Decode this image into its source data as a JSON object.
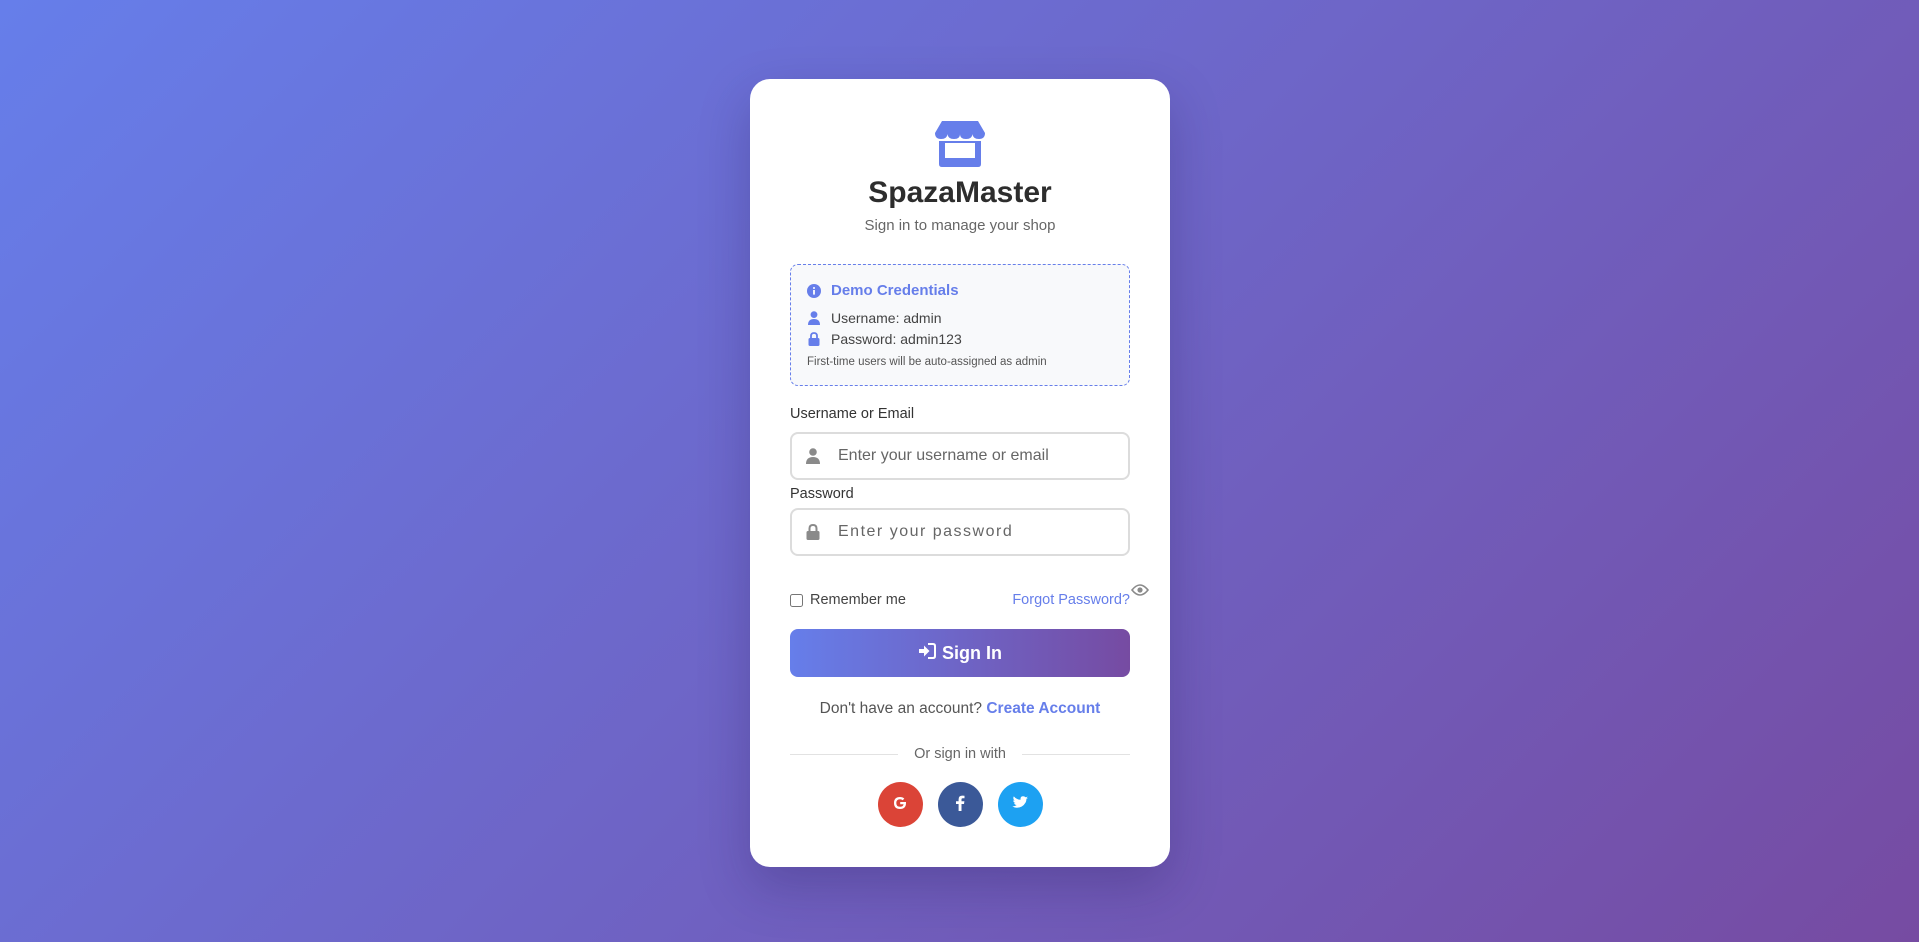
{
  "brand": {
    "title": "SpazaMaster",
    "subtitle": "Sign in to manage your shop",
    "logo_icon": "store-icon"
  },
  "demo": {
    "title": "Demo Credentials",
    "username_line": "Username: admin",
    "password_line": "Password: admin123",
    "note": "First-time users will be auto-assigned as admin"
  },
  "form": {
    "username_label": "Username or Email",
    "username_placeholder": "Enter your username or email",
    "password_label": "Password",
    "password_placeholder": "Enter your password",
    "remember_label": "Remember me",
    "forgot_label": "Forgot Password?",
    "signin_label": "Sign In"
  },
  "account": {
    "prompt": "Don't have an account?",
    "create_label": "Create Account"
  },
  "social": {
    "divider_text": "Or sign in with",
    "buttons": [
      {
        "name": "google",
        "color": "#db4437"
      },
      {
        "name": "facebook",
        "color": "#3b5998"
      },
      {
        "name": "twitter",
        "color": "#1da1f2"
      }
    ]
  },
  "colors": {
    "accent": "#667eea",
    "gradient_end": "#764ba2"
  }
}
